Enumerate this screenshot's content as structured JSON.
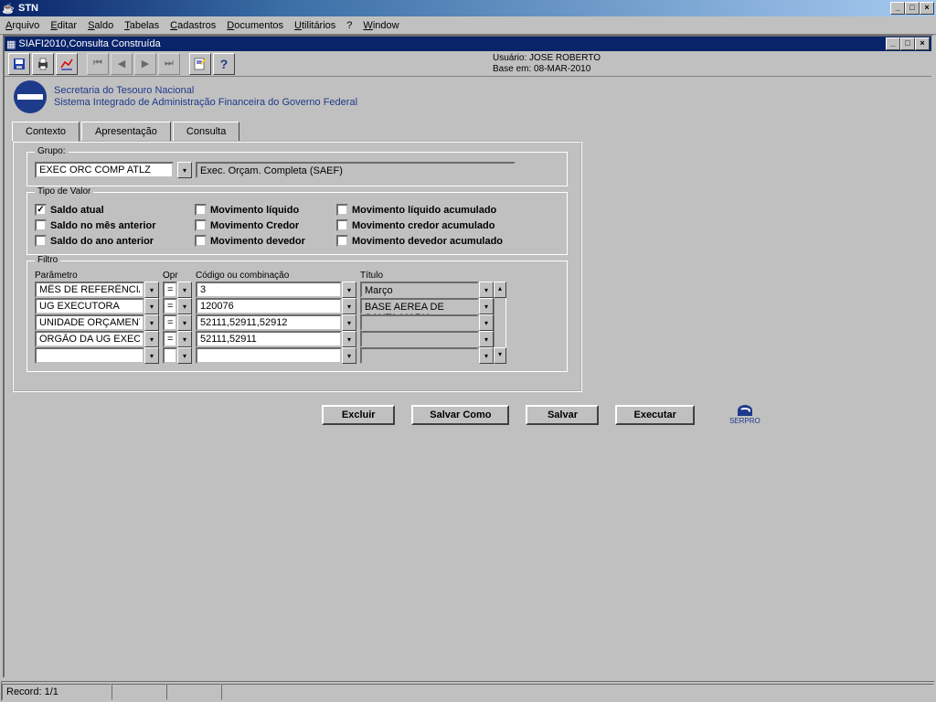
{
  "outerWindow": {
    "title": "STN"
  },
  "menu": {
    "arquivo": "Arquivo",
    "editar": "Editar",
    "saldo": "Saldo",
    "tabelas": "Tabelas",
    "cadastros": "Cadastros",
    "documentos": "Documentos",
    "utilitarios": "Utilitários",
    "ajuda": "?",
    "window": "Window"
  },
  "childWindow": {
    "title": "SIAFI2010,Consulta Construída"
  },
  "userInfo": {
    "usuarioLabel": "Usuário:",
    "usuarioValue": "JOSE ROBERTO",
    "baseLabel": "Base em:",
    "baseValue": "08-MAR-2010"
  },
  "org": {
    "line1": "Secretaria do Tesouro Nacional",
    "line2": "Sistema Integrado de Administração Financeira do Governo Federal"
  },
  "tabs": {
    "contexto": "Contexto",
    "apresentacao": "Apresentação",
    "consulta": "Consulta"
  },
  "grupo": {
    "label": "Grupo:",
    "value": "EXEC ORC COMP ATLZ",
    "desc": "Exec. Orçam. Completa (SAEF)"
  },
  "tipoValor": {
    "legend": "Tipo de Valor",
    "saldoAtual": "Saldo atual",
    "saldoMesAnterior": "Saldo no mês anterior",
    "saldoAnoAnterior": "Saldo do ano anterior",
    "movLiquido": "Movimento líquido",
    "movCredor": "Movimento Credor",
    "movDevedor": "Movimento devedor",
    "movLiquidoAcum": "Movimento líquido acumulado",
    "movCredorAcum": "Movimento credor acumulado",
    "movDevedorAcum": "Movimento devedor acumulado"
  },
  "filtro": {
    "legend": "Filtro",
    "headers": {
      "parametro": "Parâmetro",
      "opr": "Opr",
      "codigo": "Código ou combinação",
      "titulo": "Título"
    },
    "rows": [
      {
        "parametro": "MÊS DE REFERÊNCIA",
        "opr": "=",
        "codigo": "3",
        "titulo": "Março"
      },
      {
        "parametro": "UG EXECUTORA",
        "opr": "=",
        "codigo": "120076",
        "titulo": "BASE AEREA DE SANTA MARIA"
      },
      {
        "parametro": "UNIDADE ORÇAMENTÁ",
        "opr": "=",
        "codigo": "52111,52911,52912",
        "titulo": ""
      },
      {
        "parametro": "ÓRGÃO DA UG EXECU",
        "opr": "=",
        "codigo": "52111,52911",
        "titulo": ""
      },
      {
        "parametro": "",
        "opr": "",
        "codigo": "",
        "titulo": ""
      }
    ]
  },
  "buttons": {
    "excluir": "Excluir",
    "salvarComo": "Salvar Como",
    "salvar": "Salvar",
    "executar": "Executar",
    "serpro": "SERPRO"
  },
  "status": {
    "record": "Record: 1/1"
  }
}
